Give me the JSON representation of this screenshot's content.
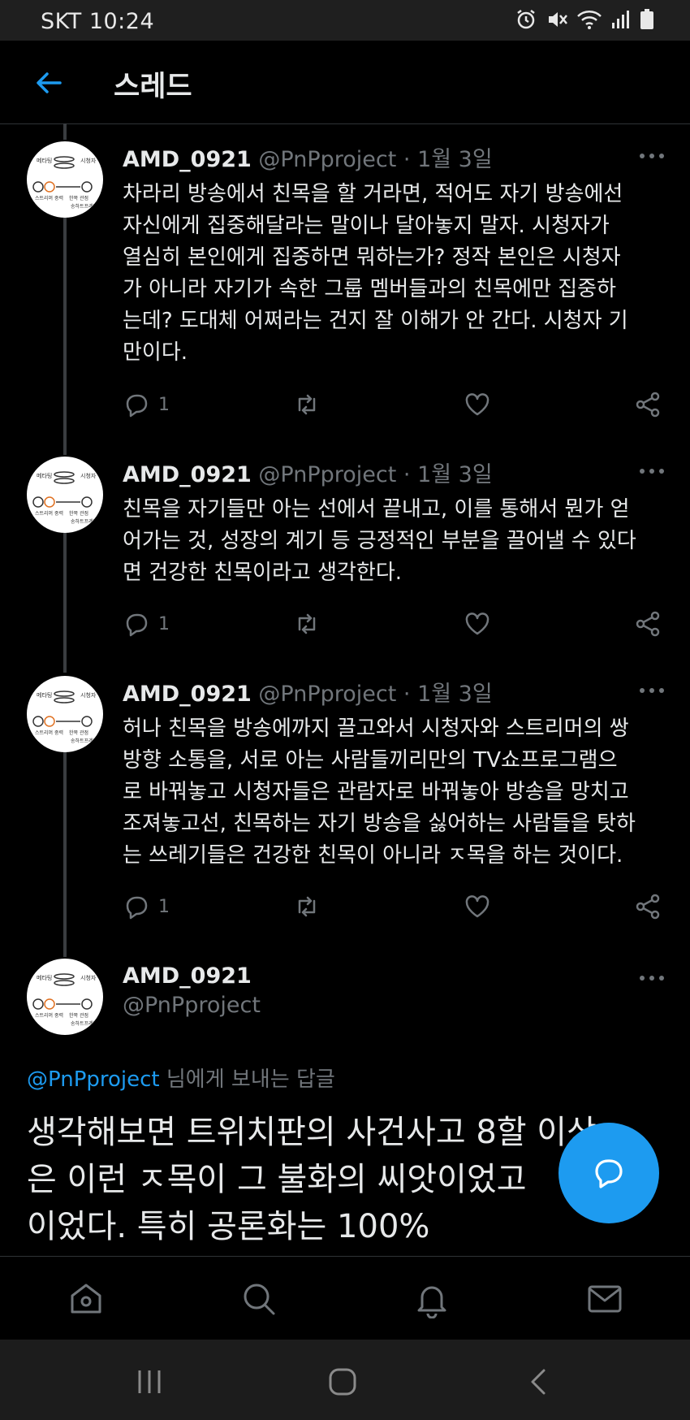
{
  "status_bar": {
    "carrier_time": "SKT 10:24",
    "icons": [
      "alarm-icon",
      "mute-icon",
      "wifi-icon",
      "signal-icon",
      "battery-icon"
    ]
  },
  "header": {
    "back_icon": "arrow-left-icon",
    "title": "스레드"
  },
  "tweets": [
    {
      "name": "AMD_0921",
      "meta": "@PnPproject · 1월 3일",
      "text": "차라리 방송에서 친목을 할 거라면, 적어도 자기 방송에선\n자신에게 집중해달라는 말이나 달아놓지 말자. 시청자가\n열심히 본인에게 집중하면 뭐하는가? 정작 본인은 시청자\n가 아니라 자기가 속한 그룹 멤버들과의 친목에만 집중하\n는데? 도대체 어쩌라는 건지 잘 이해가 안 간다. 시청자 기\n만이다.",
      "reply_count": "1"
    },
    {
      "name": "AMD_0921",
      "meta": "@PnPproject · 1월 3일",
      "text": "친목을 자기들만 아는 선에서 끝내고, 이를 통해서 뭔가 얻\n어가는 것, 성장의 계기 등 긍정적인 부분을 끌어낼 수 있다\n면 건강한 친목이라고 생각한다.",
      "reply_count": "1"
    },
    {
      "name": "AMD_0921",
      "meta": "@PnPproject · 1월 3일",
      "text": "허나 친목을 방송에까지 끌고와서 시청자와 스트리머의 쌍\n방향 소통을, 서로 아는 사람들끼리만의 TV쇼프로그램으\n로 바꿔놓고 시청자들은 관람자로 바꿔놓아 방송을 망치고\n조져놓고선, 친목하는 자기 방송을 싫어하는 사람들을 탓하\n는 쓰레기들은 건강한 친목이 아니라 ㅈ목을 하는 것이다.",
      "reply_count": "1"
    }
  ],
  "focused_tweet": {
    "name": "AMD_0921",
    "handle": "@PnPproject",
    "reply_to_mention": "@PnPproject",
    "reply_to_suffix": " 님에게 보내는 답글",
    "text": "생각해보면 트위치판의 사건사고 8할 이상\n은 이런 ㅈ목이 그 불화의 씨앗이었고\n이었다. 특히 공론화는 100%"
  },
  "fab": {
    "icon": "reply-bubble-icon"
  },
  "bottom_nav": [
    "home-icon",
    "search-icon",
    "notifications-icon",
    "messages-icon"
  ],
  "system_nav": [
    "recents-icon",
    "home-circle-icon",
    "back-chevron-icon"
  ],
  "colors": {
    "accent": "#1d9bf0",
    "background": "#000000",
    "secondary_text": "#71767b"
  }
}
